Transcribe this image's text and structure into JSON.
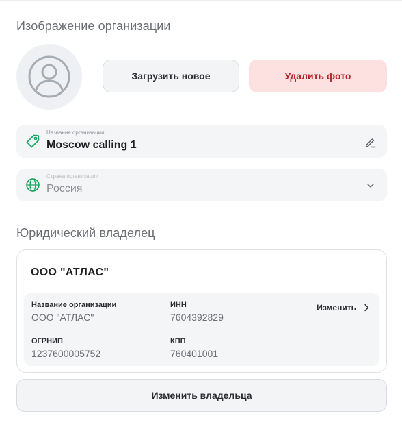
{
  "org_image": {
    "title": "Изображение организации",
    "upload_label": "Загрузить новое",
    "delete_label": "Удалить фото"
  },
  "org_name_field": {
    "label": "Название организации",
    "value": "Moscow calling 1"
  },
  "country_field": {
    "label": "Страна организации",
    "value": "Россия"
  },
  "legal_owner": {
    "title": "Юридический владелец",
    "name": "ООО \"АТЛАС\"",
    "details": {
      "org_name_label": "Название организации",
      "org_name_value": "ООО \"АТЛАС\"",
      "inn_label": "ИНН",
      "inn_value": "7604392829",
      "ogrnip_label": "ОГРНИП",
      "ogrnip_value": "1237600005752",
      "kpp_label": "КПП",
      "kpp_value": "760401001",
      "edit_label": "Изменить"
    },
    "change_owner_label": "Изменить владельца"
  },
  "colors": {
    "delete_bg": "#fde1e1",
    "delete_text": "#b4232a",
    "accent_green": "#1aa35f"
  }
}
